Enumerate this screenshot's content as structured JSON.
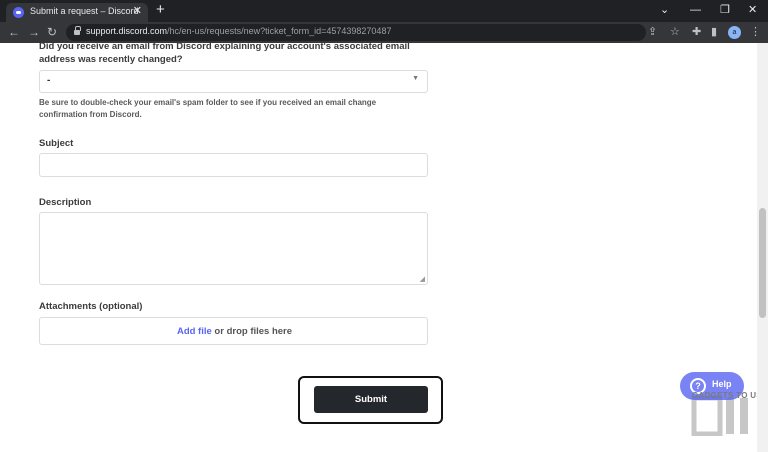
{
  "browser": {
    "tab_title": "Submit a request – Discord",
    "url_host": "support.discord.com",
    "url_path": "/hc/en-us/requests/new?ticket_form_id=4574398270487",
    "avatar_letter": "a"
  },
  "form": {
    "email_question_line1": "Did you receive an email from Discord explaining your account's associated email",
    "email_question_line2": "address was recently changed?",
    "select_value": "-",
    "spam_help_line1": "Be sure to double-check your email's spam folder to see if you received an email change",
    "spam_help_line2": "confirmation from Discord.",
    "subject_label": "Subject",
    "description_label": "Description",
    "attachments_label": "Attachments (optional)",
    "add_file_link": "Add file",
    "drop_text": " or drop files here",
    "submit_label": "Submit"
  },
  "widgets": {
    "help_label": "Help"
  },
  "watermark": {
    "text": "GADGETS TO USE."
  },
  "colors": {
    "accent": "#5865f2",
    "submit_bg": "#24272b"
  }
}
